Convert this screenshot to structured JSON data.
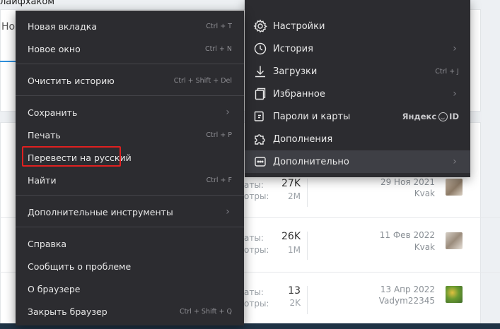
{
  "background": {
    "title_fragment": "лайфхаком",
    "input_fragment": "Но",
    "rows": [
      {
        "stat_label_1": "аты:",
        "stat_value_1": "27K",
        "stat_label_2": "отры:",
        "stat_value_2": "2M",
        "date": "29 Ноя 2021",
        "user": "Kvak"
      },
      {
        "stat_label_1": "аты:",
        "stat_value_1": "26K",
        "stat_label_2": "отры:",
        "stat_value_2": "1M",
        "date": "11 Фев 2022",
        "user": "Kvak"
      },
      {
        "stat_label_1": "аты:",
        "stat_value_1": "13",
        "stat_label_2": "отры:",
        "stat_value_2": "2K",
        "date": "13 Апр 2022",
        "user": "Vadym22345"
      }
    ]
  },
  "main_menu": {
    "new_tab": {
      "label": "Новая вкладка",
      "shortcut": "Ctrl + T"
    },
    "new_window": {
      "label": "Новое окно",
      "shortcut": "Ctrl + N"
    },
    "clear_history": {
      "label": "Очистить историю",
      "shortcut": "Ctrl + Shift + Del"
    },
    "save": {
      "label": "Сохранить"
    },
    "print": {
      "label": "Печать",
      "shortcut": "Ctrl + P"
    },
    "translate": {
      "label": "Перевести на русский"
    },
    "find": {
      "label": "Найти",
      "shortcut": "Ctrl + F"
    },
    "more_tools": {
      "label": "Дополнительные инструменты"
    },
    "help": {
      "label": "Справка"
    },
    "report": {
      "label": "Сообщить о проблеме"
    },
    "about": {
      "label": "О браузере"
    },
    "close": {
      "label": "Закрыть браузер",
      "shortcut": "Ctrl + Shift + Q"
    }
  },
  "side_menu": {
    "settings": {
      "label": "Настройки",
      "icon": "gear-icon"
    },
    "history": {
      "label": "История",
      "icon": "clock-icon"
    },
    "downloads": {
      "label": "Загрузки",
      "icon": "download-icon",
      "shortcut": "Ctrl + J"
    },
    "favorites": {
      "label": "Избранное",
      "icon": "bookmarks-icon"
    },
    "passwords": {
      "label": "Пароли и карты",
      "icon": "key-icon",
      "badge_left": "Яндекс",
      "badge_right": "ID"
    },
    "extensions": {
      "label": "Дополнения",
      "icon": "puzzle-icon"
    },
    "more": {
      "label": "Дополнительно",
      "icon": "more-dots-icon"
    }
  },
  "colors": {
    "menu_bg": "#2c2c30",
    "menu_active": "#3e3f45",
    "highlight_border": "#e02020"
  }
}
